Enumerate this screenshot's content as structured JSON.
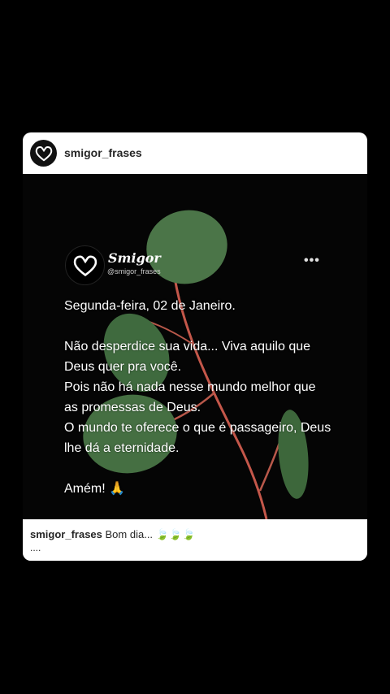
{
  "post": {
    "username": "smigor_frases",
    "inner": {
      "name": "Smigor",
      "handle": "@smigor_frases",
      "text": "Segunda-feira, 02 de Janeiro.\n\nNão desperdice sua vida... Viva aquilo que Deus quer pra você.\nPois não há nada nesse mundo melhor que as promessas de Deus.\nO mundo te oferece o que é passageiro, Deus lhe dá a eternidade.\n\nAmém! 🙏"
    },
    "caption": {
      "username": "smigor_frases",
      "text": "Bom dia... 🍃🍃🍃",
      "more": "...."
    }
  },
  "icons": {
    "avatar": "heart-logo-icon",
    "menu": "more-options-icon"
  },
  "colors": {
    "background": "#000000",
    "card": "#ffffff",
    "leaf": "#4e7a4a",
    "stem": "#c4574a"
  }
}
